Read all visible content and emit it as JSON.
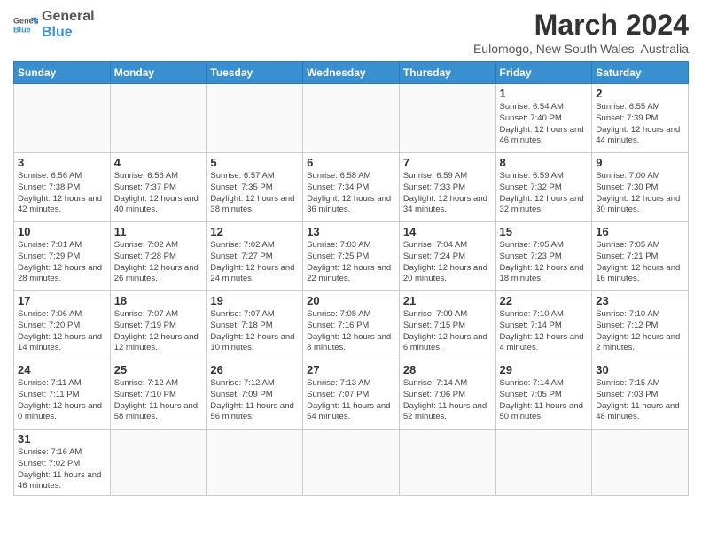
{
  "logo": {
    "text_general": "General",
    "text_blue": "Blue"
  },
  "title": "March 2024",
  "subtitle": "Eulomogo, New South Wales, Australia",
  "days_of_week": [
    "Sunday",
    "Monday",
    "Tuesday",
    "Wednesday",
    "Thursday",
    "Friday",
    "Saturday"
  ],
  "weeks": [
    [
      {
        "day": "",
        "info": ""
      },
      {
        "day": "",
        "info": ""
      },
      {
        "day": "",
        "info": ""
      },
      {
        "day": "",
        "info": ""
      },
      {
        "day": "",
        "info": ""
      },
      {
        "day": "1",
        "info": "Sunrise: 6:54 AM\nSunset: 7:40 PM\nDaylight: 12 hours and 46 minutes."
      },
      {
        "day": "2",
        "info": "Sunrise: 6:55 AM\nSunset: 7:39 PM\nDaylight: 12 hours and 44 minutes."
      }
    ],
    [
      {
        "day": "3",
        "info": "Sunrise: 6:56 AM\nSunset: 7:38 PM\nDaylight: 12 hours and 42 minutes."
      },
      {
        "day": "4",
        "info": "Sunrise: 6:56 AM\nSunset: 7:37 PM\nDaylight: 12 hours and 40 minutes."
      },
      {
        "day": "5",
        "info": "Sunrise: 6:57 AM\nSunset: 7:35 PM\nDaylight: 12 hours and 38 minutes."
      },
      {
        "day": "6",
        "info": "Sunrise: 6:58 AM\nSunset: 7:34 PM\nDaylight: 12 hours and 36 minutes."
      },
      {
        "day": "7",
        "info": "Sunrise: 6:59 AM\nSunset: 7:33 PM\nDaylight: 12 hours and 34 minutes."
      },
      {
        "day": "8",
        "info": "Sunrise: 6:59 AM\nSunset: 7:32 PM\nDaylight: 12 hours and 32 minutes."
      },
      {
        "day": "9",
        "info": "Sunrise: 7:00 AM\nSunset: 7:30 PM\nDaylight: 12 hours and 30 minutes."
      }
    ],
    [
      {
        "day": "10",
        "info": "Sunrise: 7:01 AM\nSunset: 7:29 PM\nDaylight: 12 hours and 28 minutes."
      },
      {
        "day": "11",
        "info": "Sunrise: 7:02 AM\nSunset: 7:28 PM\nDaylight: 12 hours and 26 minutes."
      },
      {
        "day": "12",
        "info": "Sunrise: 7:02 AM\nSunset: 7:27 PM\nDaylight: 12 hours and 24 minutes."
      },
      {
        "day": "13",
        "info": "Sunrise: 7:03 AM\nSunset: 7:25 PM\nDaylight: 12 hours and 22 minutes."
      },
      {
        "day": "14",
        "info": "Sunrise: 7:04 AM\nSunset: 7:24 PM\nDaylight: 12 hours and 20 minutes."
      },
      {
        "day": "15",
        "info": "Sunrise: 7:05 AM\nSunset: 7:23 PM\nDaylight: 12 hours and 18 minutes."
      },
      {
        "day": "16",
        "info": "Sunrise: 7:05 AM\nSunset: 7:21 PM\nDaylight: 12 hours and 16 minutes."
      }
    ],
    [
      {
        "day": "17",
        "info": "Sunrise: 7:06 AM\nSunset: 7:20 PM\nDaylight: 12 hours and 14 minutes."
      },
      {
        "day": "18",
        "info": "Sunrise: 7:07 AM\nSunset: 7:19 PM\nDaylight: 12 hours and 12 minutes."
      },
      {
        "day": "19",
        "info": "Sunrise: 7:07 AM\nSunset: 7:18 PM\nDaylight: 12 hours and 10 minutes."
      },
      {
        "day": "20",
        "info": "Sunrise: 7:08 AM\nSunset: 7:16 PM\nDaylight: 12 hours and 8 minutes."
      },
      {
        "day": "21",
        "info": "Sunrise: 7:09 AM\nSunset: 7:15 PM\nDaylight: 12 hours and 6 minutes."
      },
      {
        "day": "22",
        "info": "Sunrise: 7:10 AM\nSunset: 7:14 PM\nDaylight: 12 hours and 4 minutes."
      },
      {
        "day": "23",
        "info": "Sunrise: 7:10 AM\nSunset: 7:12 PM\nDaylight: 12 hours and 2 minutes."
      }
    ],
    [
      {
        "day": "24",
        "info": "Sunrise: 7:11 AM\nSunset: 7:11 PM\nDaylight: 12 hours and 0 minutes."
      },
      {
        "day": "25",
        "info": "Sunrise: 7:12 AM\nSunset: 7:10 PM\nDaylight: 11 hours and 58 minutes."
      },
      {
        "day": "26",
        "info": "Sunrise: 7:12 AM\nSunset: 7:09 PM\nDaylight: 11 hours and 56 minutes."
      },
      {
        "day": "27",
        "info": "Sunrise: 7:13 AM\nSunset: 7:07 PM\nDaylight: 11 hours and 54 minutes."
      },
      {
        "day": "28",
        "info": "Sunrise: 7:14 AM\nSunset: 7:06 PM\nDaylight: 11 hours and 52 minutes."
      },
      {
        "day": "29",
        "info": "Sunrise: 7:14 AM\nSunset: 7:05 PM\nDaylight: 11 hours and 50 minutes."
      },
      {
        "day": "30",
        "info": "Sunrise: 7:15 AM\nSunset: 7:03 PM\nDaylight: 11 hours and 48 minutes."
      }
    ],
    [
      {
        "day": "31",
        "info": "Sunrise: 7:16 AM\nSunset: 7:02 PM\nDaylight: 11 hours and 46 minutes."
      },
      {
        "day": "",
        "info": ""
      },
      {
        "day": "",
        "info": ""
      },
      {
        "day": "",
        "info": ""
      },
      {
        "day": "",
        "info": ""
      },
      {
        "day": "",
        "info": ""
      },
      {
        "day": "",
        "info": ""
      }
    ]
  ]
}
